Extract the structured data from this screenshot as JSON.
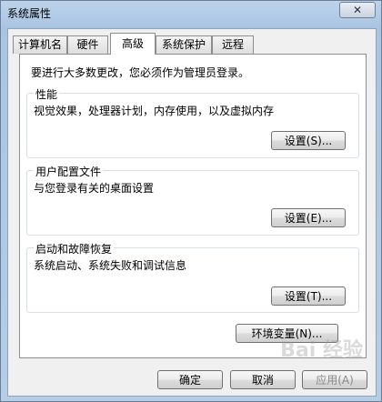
{
  "window": {
    "title": "系统属性",
    "close_glyph": "✕"
  },
  "tabs": [
    {
      "label": "计算机名"
    },
    {
      "label": "硬件"
    },
    {
      "label": "高级"
    },
    {
      "label": "系统保护"
    },
    {
      "label": "远程"
    }
  ],
  "panel": {
    "notice": "要进行大多数更改，您必须作为管理员登录。",
    "performance": {
      "title": "性能",
      "desc": "视觉效果，处理器计划，内存使用，以及虚拟内存",
      "button": "设置(S)..."
    },
    "profiles": {
      "title": "用户配置文件",
      "desc": "与您登录有关的桌面设置",
      "button": "设置(E)..."
    },
    "startup": {
      "title": "启动和故障恢复",
      "desc": "系统启动、系统失败和调试信息",
      "button": "设置(T)..."
    },
    "env_button": "环境变量(N)..."
  },
  "footer": {
    "ok": "确定",
    "cancel": "取消",
    "apply": "应用(A)"
  },
  "watermark": "Bai 经验"
}
